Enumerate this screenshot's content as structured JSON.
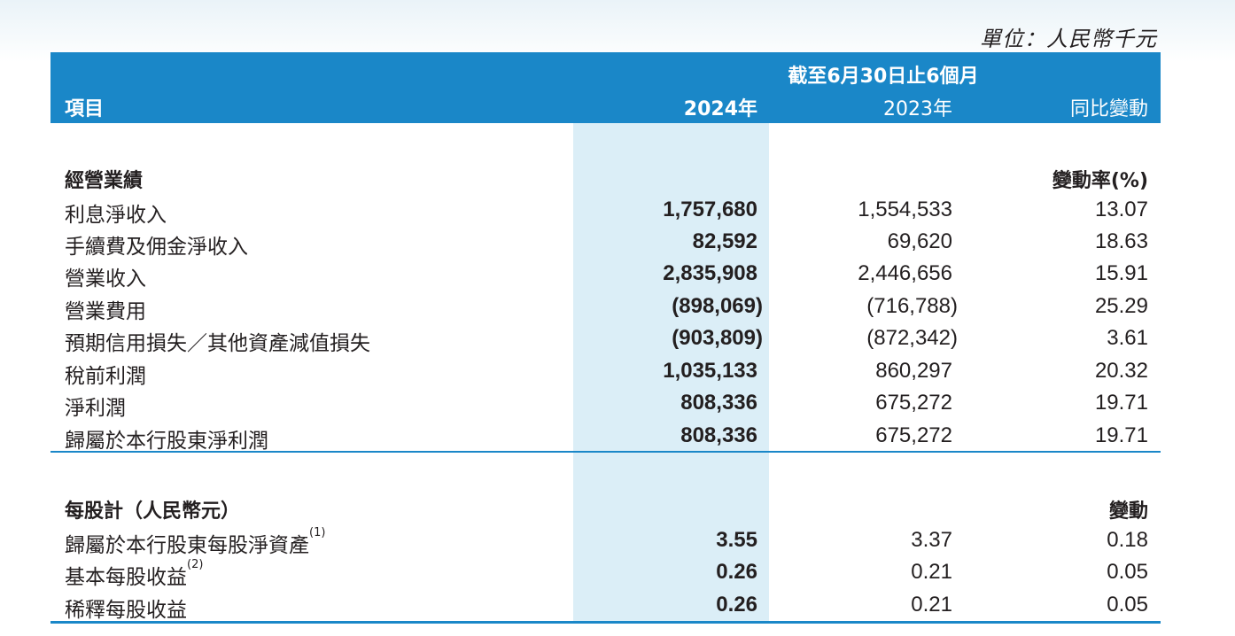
{
  "unit_label": "單位：人民幣千元",
  "header": {
    "period": "截至6月30日止6個月",
    "item": "項目",
    "col_2024": "2024年",
    "col_2023": "2023年",
    "col_change": "同比變動"
  },
  "section1": {
    "title": "經營業績",
    "change_header": "變動率(%)",
    "rows": [
      {
        "label": "利息淨收入",
        "v2024": "1,757,680",
        "v2023": "1,554,533",
        "change": "13.07"
      },
      {
        "label": "手續費及佣金淨收入",
        "v2024": "82,592",
        "v2023": "69,620",
        "change": "18.63"
      },
      {
        "label": "營業收入",
        "v2024": "2,835,908",
        "v2023": "2,446,656",
        "change": "15.91"
      },
      {
        "label": "營業費用",
        "v2024": "(898,069)",
        "v2023": "(716,788)",
        "change": "25.29"
      },
      {
        "label": "預期信用損失／其他資產減值損失",
        "v2024": "(903,809)",
        "v2023": "(872,342)",
        "change": "3.61"
      },
      {
        "label": "稅前利潤",
        "v2024": "1,035,133",
        "v2023": "860,297",
        "change": "20.32"
      },
      {
        "label": "淨利潤",
        "v2024": "808,336",
        "v2023": "675,272",
        "change": "19.71"
      },
      {
        "label": "歸屬於本行股東淨利潤",
        "v2024": "808,336",
        "v2023": "675,272",
        "change": "19.71"
      }
    ]
  },
  "section2": {
    "title": "每股計（人民幣元）",
    "change_header": "變動",
    "rows": [
      {
        "label": "歸屬於本行股東每股淨資產",
        "note": "(1)",
        "v2024": "3.55",
        "v2023": "3.37",
        "change": "0.18"
      },
      {
        "label": "基本每股收益",
        "note": "(2)",
        "v2024": "0.26",
        "v2023": "0.21",
        "change": "0.05"
      },
      {
        "label": "稀釋每股收益",
        "note": "",
        "v2024": "0.26",
        "v2023": "0.21",
        "change": "0.05"
      }
    ]
  }
}
